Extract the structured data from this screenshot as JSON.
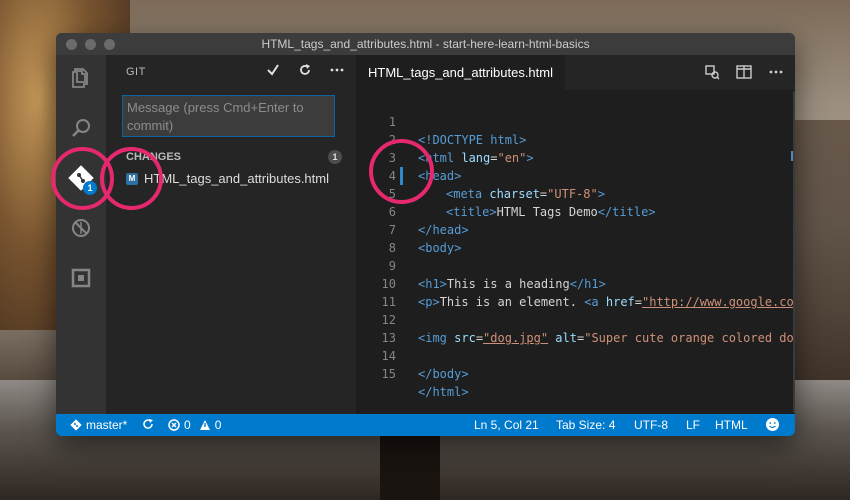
{
  "window": {
    "title": "HTML_tags_and_attributes.html - start-here-learn-html-basics"
  },
  "activity": {
    "git_badge": "1"
  },
  "sidebar": {
    "header": "GIT",
    "commit_icon": "checkmark-icon",
    "refresh_icon": "refresh-icon",
    "more_icon": "ellipsis-icon",
    "message_placeholder": "Message (press Cmd+Enter to commit)",
    "changes_label": "CHANGES",
    "changes_count": "1",
    "file_status": "M",
    "file_name": "HTML_tags_and_attributes.html"
  },
  "editor": {
    "tab_label": "HTML_tags_and_attributes.html",
    "lines": [
      {
        "n": "1"
      },
      {
        "n": "2"
      },
      {
        "n": "3"
      },
      {
        "n": "4"
      },
      {
        "n": "5"
      },
      {
        "n": "6"
      },
      {
        "n": "7"
      },
      {
        "n": "8"
      },
      {
        "n": "9"
      },
      {
        "n": "10"
      },
      {
        "n": "11"
      },
      {
        "n": "12"
      },
      {
        "n": "13"
      },
      {
        "n": "14"
      },
      {
        "n": "15"
      }
    ],
    "code": {
      "l1": "<!DOCTYPE html>",
      "l2_open": "<html",
      "l2_attr": " lang",
      "l2_eq": "=",
      "l2_val": "\"en\"",
      "l2_close": ">",
      "l3": "<head>",
      "l4_open": "<meta",
      "l4_attr": " charset",
      "l4_eq": "=",
      "l4_val": "\"UTF-8\"",
      "l4_close": ">",
      "l5_open": "<title>",
      "l5_text": "HTML Tags Demo",
      "l5_close": "</title>",
      "l6": "</head>",
      "l7": "<body>",
      "l9_open": "<h1>",
      "l9_text": "This is a heading",
      "l9_close": "</h1>",
      "l10_open": "<p>",
      "l10_text": "This is an element. ",
      "l10_a": "<a",
      "l10_attr": " href",
      "l10_eq": "=",
      "l10_val": "\"http://www.google.com",
      "l12_open": "<img",
      "l12_attr1": " src",
      "l12_eq1": "=",
      "l12_val1": "\"dog.jpg\"",
      "l12_attr2": " alt",
      "l12_eq2": "=",
      "l12_val2": "\"Super cute orange colored dog",
      "l14": "</body>",
      "l15": "</html>"
    }
  },
  "statusbar": {
    "branch": "master*",
    "errors": "0",
    "warnings": "0",
    "position": "Ln 5, Col 21",
    "tab_size": "Tab Size: 4",
    "encoding": "UTF-8",
    "eol": "LF",
    "language": "HTML"
  },
  "colors": {
    "accent": "#007acc",
    "highlight_circle": "#e6286e"
  }
}
